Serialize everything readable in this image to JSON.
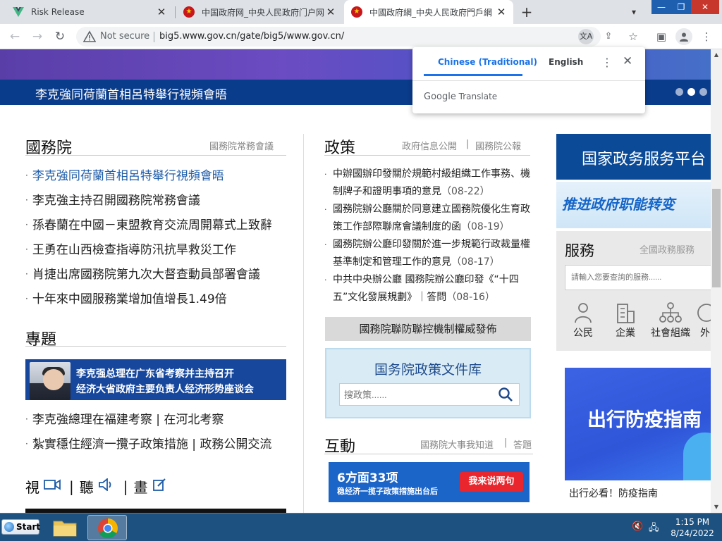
{
  "browser": {
    "tabs": [
      {
        "title": "Risk Release"
      },
      {
        "title": "中国政府网_中央人民政府门户网"
      },
      {
        "title": "中國政府網_中央人民政府門戶網"
      }
    ],
    "new_tab": "+",
    "address": {
      "security_text": "Not secure",
      "url": "big5.www.gov.cn/gate/big5/www.gov.cn/"
    }
  },
  "translate_popup": {
    "source_lang": "Chinese (Traditional)",
    "target_lang": "English",
    "footer_brand": "Google",
    "footer_text": "Translate"
  },
  "hero": {
    "title": "李克強同荷蘭首相呂特舉行視頻會晤",
    "dots": 3,
    "active_dot": 1
  },
  "state_council": {
    "title": "國務院",
    "right_link": "國務院常務會議",
    "items": [
      "李克強同荷蘭首相呂特舉行視頻會晤",
      "李克強主持召開國務院常務會議",
      "孫春蘭在中國－東盟教育交流周開幕式上致辭",
      "王勇在山西檢查指導防汛抗旱救災工作",
      "肖捷出席國務院第九次大督查動員部署會議",
      "十年來中國服務業增加值增長1.49倍"
    ]
  },
  "topics": {
    "title": "專題",
    "banner_line1": "李克强总理在广东省考察并主持召开",
    "banner_line2": "经济大省政府主要负责人经济形势座谈会",
    "items": [
      "李克強總理在福建考察 | 在河北考察",
      "紮實穩住經濟一攬子政策措施 | 政務公開交流"
    ]
  },
  "media": {
    "video": "視",
    "audio": "聽",
    "picture": "畫",
    "separator": "|"
  },
  "policy": {
    "title": "政策",
    "right_link_1": "政府信息公開",
    "right_sep": "|",
    "right_link_2": "國務院公報",
    "items": [
      {
        "text": "中辦國辦印發關於規範村級組織工作事務、機制牌子和證明事項的意見",
        "date": "（08-22）"
      },
      {
        "text": "國務院辦公廳關於同意建立國務院優化生育政策工作部際聯席會議制度的函",
        "date": "（08-19）"
      },
      {
        "text": "國務院辦公廳印發關於進一步規範行政裁量權基準制定和管理工作的意見",
        "date": "（08-17）"
      },
      {
        "text": "中共中央辦公廳 國務院辦公廳印發《“十四五”文化發展規劃》｜答問",
        "date": "（08-16）"
      }
    ],
    "gray_button": "國務院聯防聯控機制權威發佈",
    "library_title": "国务院政策文件库",
    "search_placeholder": "搜政策......"
  },
  "interaction": {
    "title": "互動",
    "right_link_1": "國務院大事我知道",
    "right_sep": "|",
    "right_link_2": "答題",
    "banner_big": "6方面33项",
    "banner_small": "稳经济一揽子政策措施出台后",
    "banner_button": "我来说两句"
  },
  "right_column": {
    "header": "国家政务服务平台",
    "banner": "推进政府职能转变",
    "service_title": "服務",
    "service_right": "全國政務服務",
    "service_placeholder": "請輸入您要查詢的服務......",
    "service_icons": [
      {
        "label": "公民"
      },
      {
        "label": "企業"
      },
      {
        "label": "社會組織"
      },
      {
        "label": "外"
      }
    ],
    "travel_image_text": "出行防疫指南",
    "travel_caption": "出行必看！防疫指南"
  },
  "taskbar": {
    "start": "Start",
    "time": "1:15 PM",
    "date": "8/24/2022"
  },
  "colors": {
    "gov_blue": "#0b4a97",
    "link_blue": "#1f5da8",
    "hero_bar": "#0a3c8c",
    "chrome_tabbar": "#dee1e6",
    "translate_blue": "#1a73e8",
    "taskbar": "#1c5180"
  }
}
